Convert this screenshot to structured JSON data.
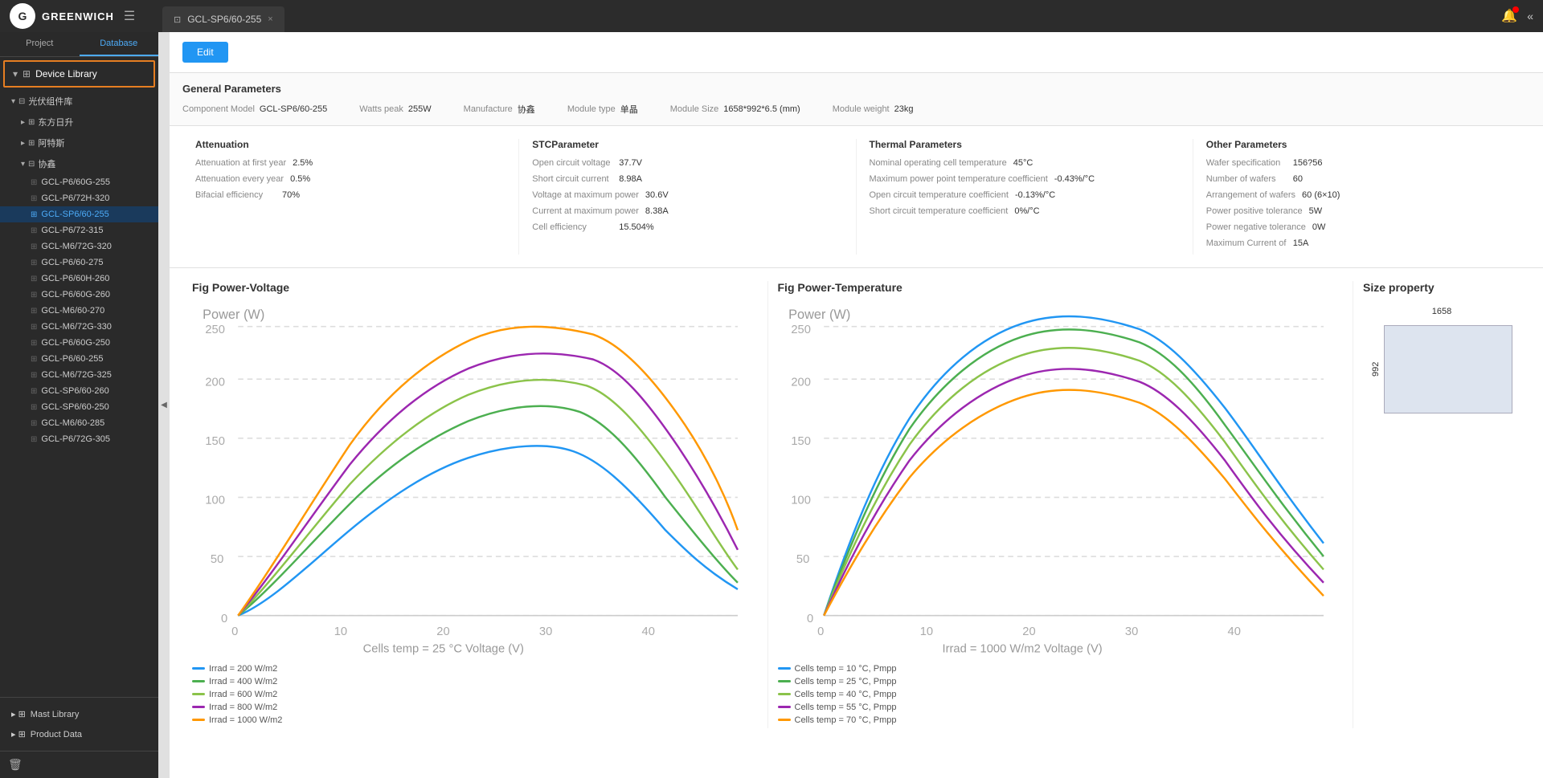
{
  "topbar": {
    "logo": "G",
    "brand": "GREENWICH",
    "tab_label": "GCL-SP6/60-255",
    "tab_close": "×"
  },
  "nav": {
    "project": "Project",
    "database": "Database"
  },
  "sidebar": {
    "device_library": "Device Library",
    "groups": [
      {
        "name": "光伏组件库",
        "expanded": true,
        "children": [
          {
            "name": "东方日升",
            "expanded": false,
            "items": []
          },
          {
            "name": "阿特斯",
            "expanded": false,
            "items": []
          },
          {
            "name": "协鑫",
            "expanded": true,
            "items": [
              "GCL-P6/60G-255",
              "GCL-P6/72H-320",
              "GCL-SP6/60-255",
              "GCL-P6/72-315",
              "GCL-M6/72G-320",
              "GCL-P6/60-275",
              "GCL-P6/60H-260",
              "GCL-P6/60G-260",
              "GCL-M6/60-270",
              "GCL-M6/72G-330",
              "GCL-P6/60G-250",
              "GCL-P6/60-255",
              "GCL-M6/72G-325",
              "GCL-SP6/60-260",
              "GCL-SP6/60-250",
              "GCL-M6/60-285",
              "GCL-P6/72G-305"
            ]
          }
        ]
      }
    ],
    "mast_library": "Mast Library",
    "product_data": "Product Data"
  },
  "content": {
    "edit_button": "Edit",
    "general_params_title": "General Parameters",
    "params": {
      "component_model_label": "Component Model",
      "component_model_value": "GCL-SP6/60-255",
      "watts_peak_label": "Watts peak",
      "watts_peak_value": "255W",
      "manufacture_label": "Manufacture",
      "manufacture_value": "协鑫",
      "module_type_label": "Module type",
      "module_type_value": "单晶",
      "module_size_label": "Module Size",
      "module_size_value": "1658*992*6.5  (mm)",
      "module_weight_label": "Module weight",
      "module_weight_value": "23kg"
    },
    "attenuation": {
      "title": "Attenuation",
      "rows": [
        {
          "key": "Attenuation at first year",
          "val": "2.5%"
        },
        {
          "key": "Attenuation every year",
          "val": "0.5%"
        },
        {
          "key": "Bifacial efficiency",
          "val": "70%"
        }
      ]
    },
    "stc": {
      "title": "STCParameter",
      "rows": [
        {
          "key": "Open circuit voltage",
          "val": "37.7V"
        },
        {
          "key": "Short circuit current",
          "val": "8.98A"
        },
        {
          "key": "Voltage at maximum power",
          "val": "30.6V"
        },
        {
          "key": "Current at maximum power",
          "val": "8.38A"
        },
        {
          "key": "Cell efficiency",
          "val": "15.504%"
        }
      ]
    },
    "thermal": {
      "title": "Thermal Parameters",
      "rows": [
        {
          "key": "Nominal operating cell temperature",
          "val": "45°C"
        },
        {
          "key": "Maximum power point temperature coefficient",
          "val": "-0.43%/°C"
        },
        {
          "key": "Open circuit temperature coefficient",
          "val": "-0.13%/°C"
        },
        {
          "key": "Short circuit temperature coefficient",
          "val": "0%/°C"
        }
      ]
    },
    "other": {
      "title": "Other Parameters",
      "rows": [
        {
          "key": "Wafer specification",
          "val": "156?56"
        },
        {
          "key": "Number of wafers",
          "val": "60"
        },
        {
          "key": "Arrangement of wafers",
          "val": "60  (6×10)"
        },
        {
          "key": "Power positive tolerance",
          "val": "5W"
        },
        {
          "key": "Power negative tolerance",
          "val": "0W"
        },
        {
          "key": "Maximum Current of",
          "val": "15A"
        }
      ]
    },
    "chart1": {
      "title": "Fig Power-Voltage",
      "x_label": "Voltage (V)",
      "x_note": "Cells temp = 25 °C",
      "y_label": "Power (W)",
      "y_max": 300,
      "legend": [
        {
          "label": "Irrad = 200 W/m2",
          "color": "#2196F3"
        },
        {
          "label": "Irrad = 400 W/m2",
          "color": "#4CAF50"
        },
        {
          "label": "Irrad = 600 W/m2",
          "color": "#8BC34A"
        },
        {
          "label": "Irrad = 800 W/m2",
          "color": "#9C27B0"
        },
        {
          "label": "Irrad = 1000 W/m2",
          "color": "#FF9800"
        }
      ]
    },
    "chart2": {
      "title": "Fig Power-Temperature",
      "x_label": "Voltage (V)",
      "x_note": "Irrad = 1000 W/m2",
      "y_label": "Power (W)",
      "y_max": 300,
      "legend": [
        {
          "label": "Cells temp = 10 °C,  Pmpp",
          "color": "#2196F3"
        },
        {
          "label": "Cells temp = 25 °C,  Pmpp",
          "color": "#4CAF50"
        },
        {
          "label": "Cells temp = 40 °C,  Pmpp",
          "color": "#8BC34A"
        },
        {
          "label": "Cells temp = 55 °C,  Pmpp",
          "color": "#9C27B0"
        },
        {
          "label": "Cells temp = 70 °C,  Pmpp",
          "color": "#FF9800"
        }
      ]
    },
    "size_property": {
      "title": "Size property",
      "width": "1658",
      "height": "992"
    }
  }
}
